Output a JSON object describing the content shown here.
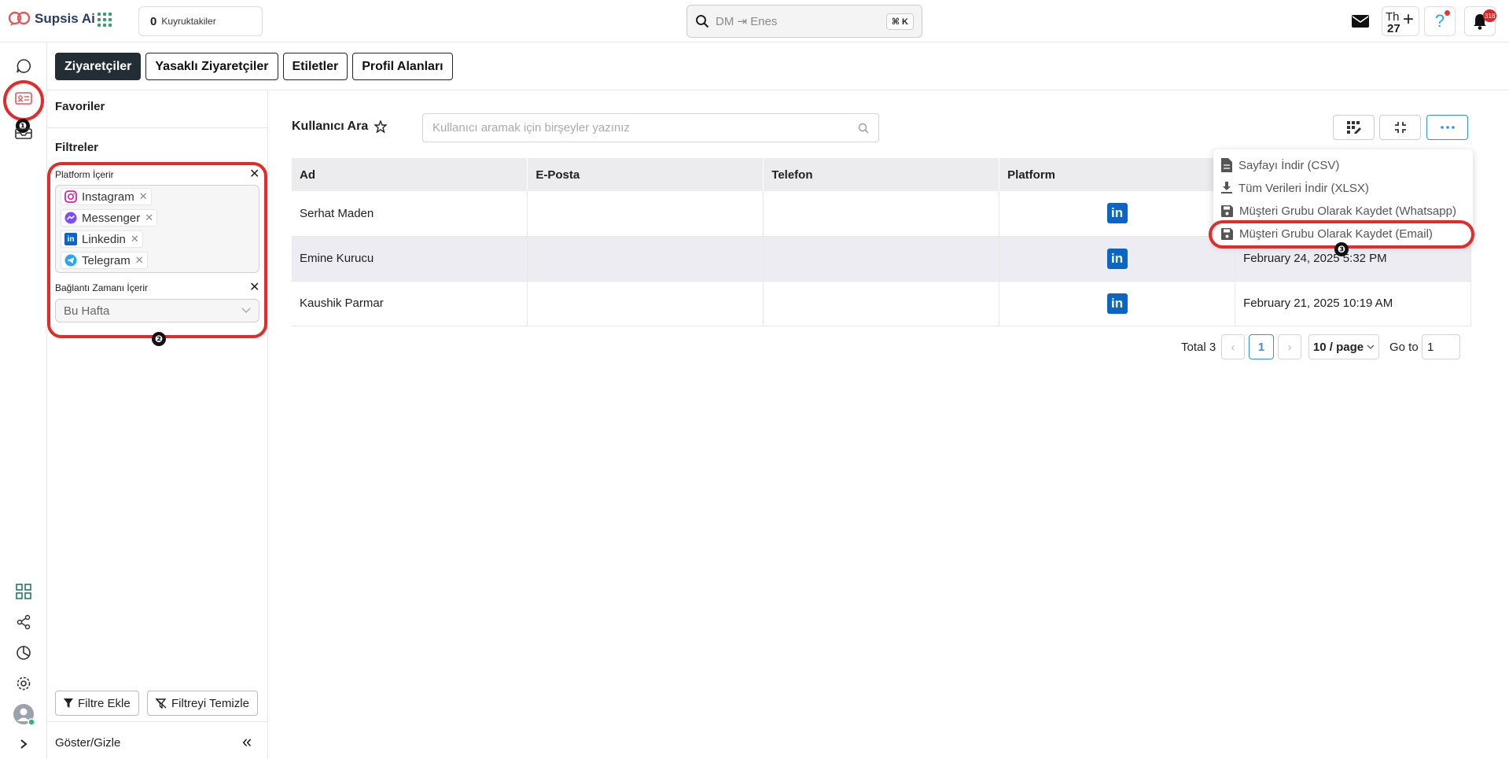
{
  "app": {
    "name": "Supsis Ai",
    "queue_count": "0",
    "queue_label": "Kuyruktakiler",
    "cmd_placeholder": "DM ⇥ Enes",
    "cmd_shortcut": "⌘ K",
    "calendar_day": "Th",
    "calendar_date": "27",
    "help_icon": "?",
    "notification_count": "318"
  },
  "tabs": [
    "Ziyaretçiler",
    "Yasaklı Ziyaretçiler",
    "Etiletler",
    "Profil Alanları"
  ],
  "filters": {
    "favorites": "Favoriler",
    "title": "Filtreler",
    "platform_label": "Platform İçerir",
    "platforms": [
      "Instagram",
      "Messenger",
      "Linkedin",
      "Telegram"
    ],
    "connection_label": "Bağlantı Zamanı İçerir",
    "connection_value": "Bu Hafta",
    "add_filter": "Filtre Ekle",
    "clear_filter": "Filtreyi Temizle",
    "toggle": "Göster/Gizle",
    "collapse": "«"
  },
  "main": {
    "title": "Kullanıcı Ara",
    "search_placeholder": "Kullanıcı aramak için birşeyler yazınız",
    "columns": [
      "Ad",
      "E-Posta",
      "Telefon",
      "Platform",
      ""
    ],
    "rows": [
      {
        "name": "Serhat Maden",
        "email": "",
        "phone": "",
        "platform": "in",
        "date": ""
      },
      {
        "name": "Emine Kurucu",
        "email": "",
        "phone": "",
        "platform": "in",
        "date": "February 24, 2025 5:32 PM"
      },
      {
        "name": "Kaushik Parmar",
        "email": "",
        "phone": "",
        "platform": "in",
        "date": "February 21, 2025 10:19 AM"
      }
    ],
    "pagination": {
      "total": "Total 3",
      "prev": "‹",
      "current": "1",
      "next": "›",
      "per_page": "10 / page",
      "goto_label": "Go to",
      "goto_value": "1"
    }
  },
  "menu": {
    "items": [
      "Sayfayı İndir (CSV)",
      "Tüm Verileri İndir (XLSX)",
      "Müşteri Grubu Olarak Kaydet (Whatsapp)",
      "Müşteri Grubu Olarak Kaydet (Email)"
    ]
  },
  "markers": [
    "❶",
    "❷",
    "❸"
  ],
  "colors": {
    "highlight": "#e32b2b",
    "active_tab": "#222d35",
    "linkedin": "#0a66c2",
    "accent": "#3a8fe0"
  }
}
